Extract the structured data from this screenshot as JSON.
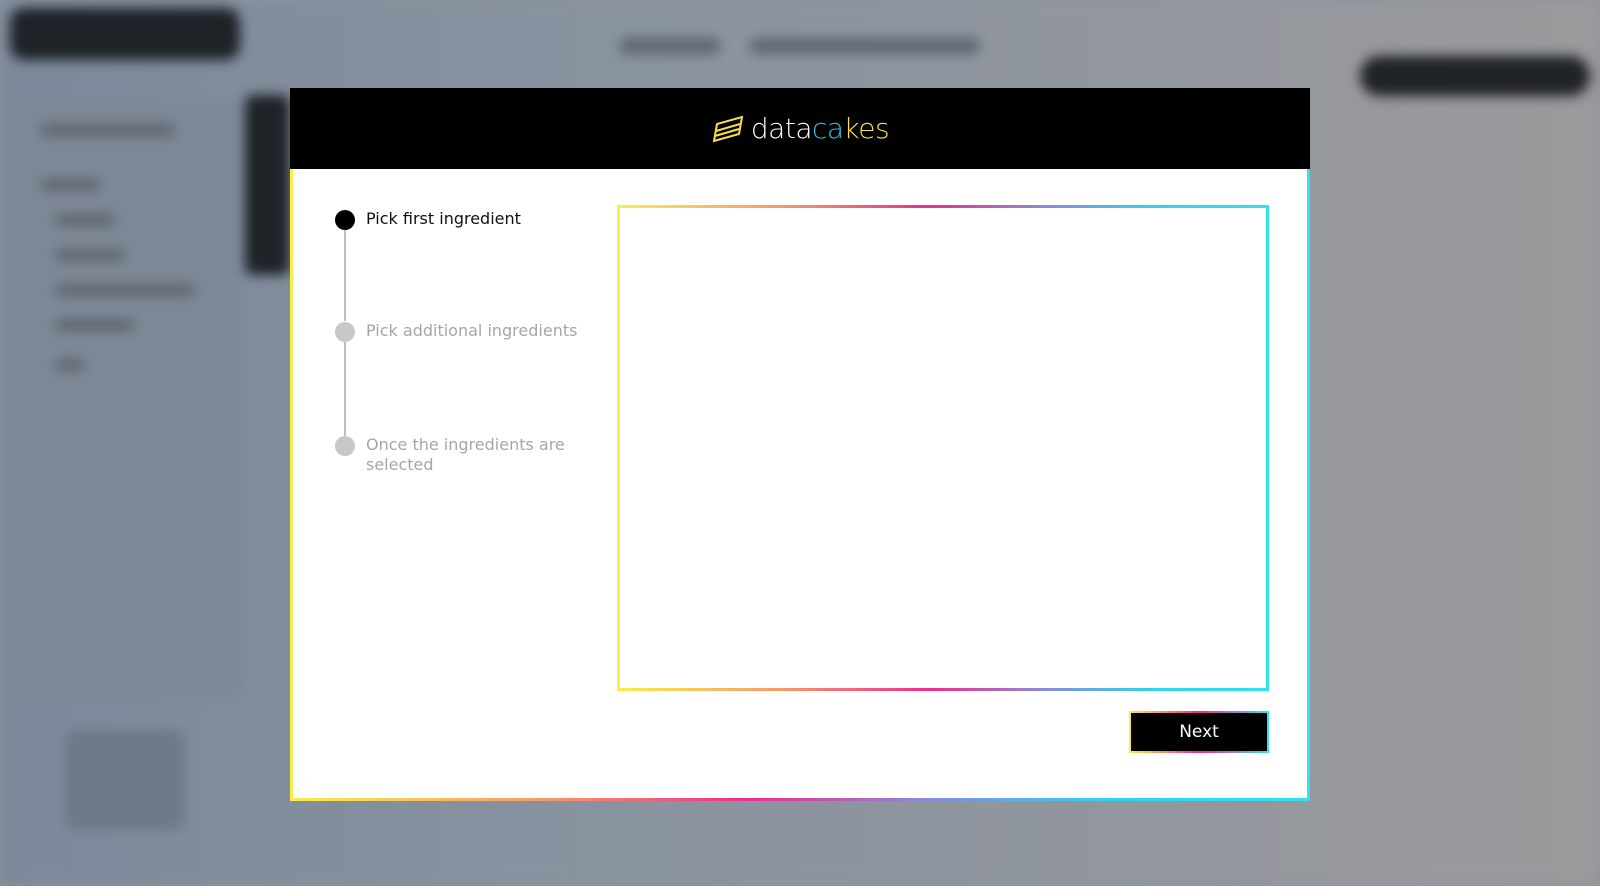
{
  "brand": {
    "logo_part1": "data",
    "logo_part2": "ca",
    "logo_part3": "kes"
  },
  "wizard": {
    "steps": [
      {
        "label": "Pick first ingredient",
        "state": "active"
      },
      {
        "label": "Pick additional ingredients",
        "state": "inactive"
      },
      {
        "label": "Once the ingredients are selected",
        "state": "inactive"
      }
    ],
    "next_label": "Next"
  },
  "colors": {
    "header_bg": "#000000",
    "gradient_yellow": "#f9ee4a",
    "gradient_pink": "#ee2c8e",
    "gradient_cyan": "#2fe2ee",
    "active_step": "#000000",
    "inactive_step": "#c8c8c8"
  },
  "icons": {
    "logo": "stacked-cake-layers-icon"
  }
}
